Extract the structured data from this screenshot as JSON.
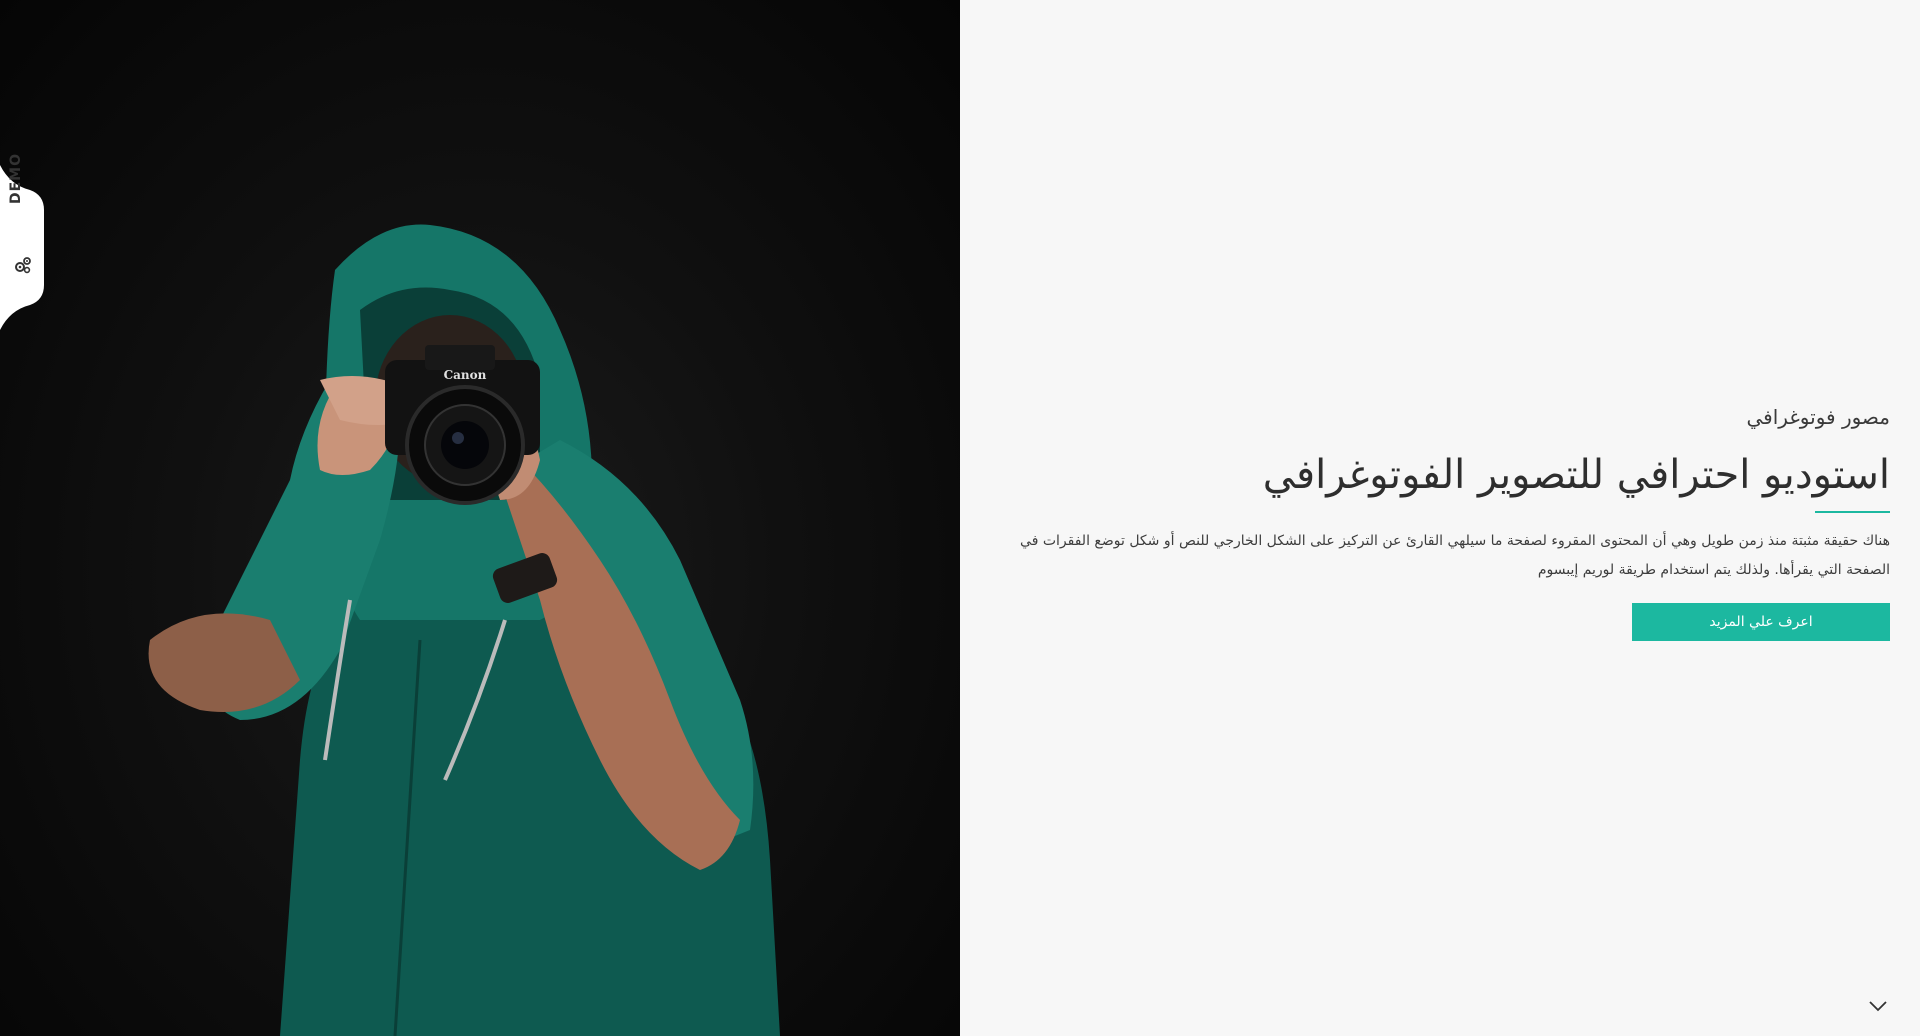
{
  "demo_tab": {
    "label": "DEMO",
    "icon": "gears-icon"
  },
  "hero": {
    "subtitle": "مصور فوتوغرافي",
    "title": "استوديو احترافي للتصوير الفوتوغرافي",
    "description": "هناك حقيقة مثبتة منذ زمن طويل وهي أن المحتوى المقروء لصفحة ما سيلهي القارئ عن التركيز على الشكل الخارجي للنص أو شكل توضع الفقرات في الصفحة التي يقرأها. ولذلك يتم استخدام طريقة لوريم إيبسوم",
    "button_label": "اعرف علي المزيد"
  },
  "scroll_icon": "chevron-down-icon",
  "colors": {
    "accent": "#1cb8a0",
    "background": "#f7f7f7",
    "photo_bg": "#0d0d0d"
  }
}
